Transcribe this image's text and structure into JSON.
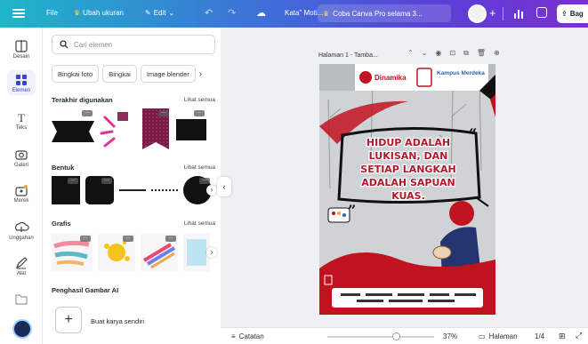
{
  "topbar": {
    "file_label": "File",
    "resize_label": "Ubah ukuran",
    "edit_label": "Edit",
    "doc_title": "Kata\" Moti...",
    "promo_label": "Coba Canva Pro selama 3...",
    "share_label": "Bag"
  },
  "rail": {
    "items": [
      {
        "label": "Desain",
        "icon": "layout-icon"
      },
      {
        "label": "Elemen",
        "icon": "elements-icon"
      },
      {
        "label": "Teks",
        "icon": "text-icon"
      },
      {
        "label": "Galeri",
        "icon": "camera-icon"
      },
      {
        "label": "Merek",
        "icon": "brand-icon"
      },
      {
        "label": "Unggahan",
        "icon": "upload-icon"
      },
      {
        "label": "Alat",
        "icon": "pen-icon"
      },
      {
        "label": "",
        "icon": "folder-icon"
      }
    ]
  },
  "panel": {
    "search_placeholder": "Cari elemen",
    "chips": [
      "Bingkai foto",
      "Bingkai",
      "Image blender"
    ],
    "recent_title": "Terakhir digunakan",
    "see_all": "Lihat semua",
    "shapes_title": "Bentuk",
    "graphics_title": "Grafis",
    "ai_title": "Penghasil Gambar AI",
    "create_label": "Buat karya sendiri"
  },
  "canvas": {
    "page_label": "Halaman 1 - Tamba...",
    "poster": {
      "brand_1": "Dinamika",
      "brand_2": "Kampus Merdeka",
      "headline": "HIDUP ADALAH LUKISAN, DAN SETIAP LANGKAH ADALAH SAPUAN KUAS."
    }
  },
  "bottombar": {
    "notes_label": "Catatan",
    "zoom": "37%",
    "pages_label": "Halaman",
    "page_count": "1/4"
  },
  "colors": {
    "accent": "#3a46c7",
    "poster_red": "#c1121f",
    "headline_fill": "#b0192b"
  }
}
